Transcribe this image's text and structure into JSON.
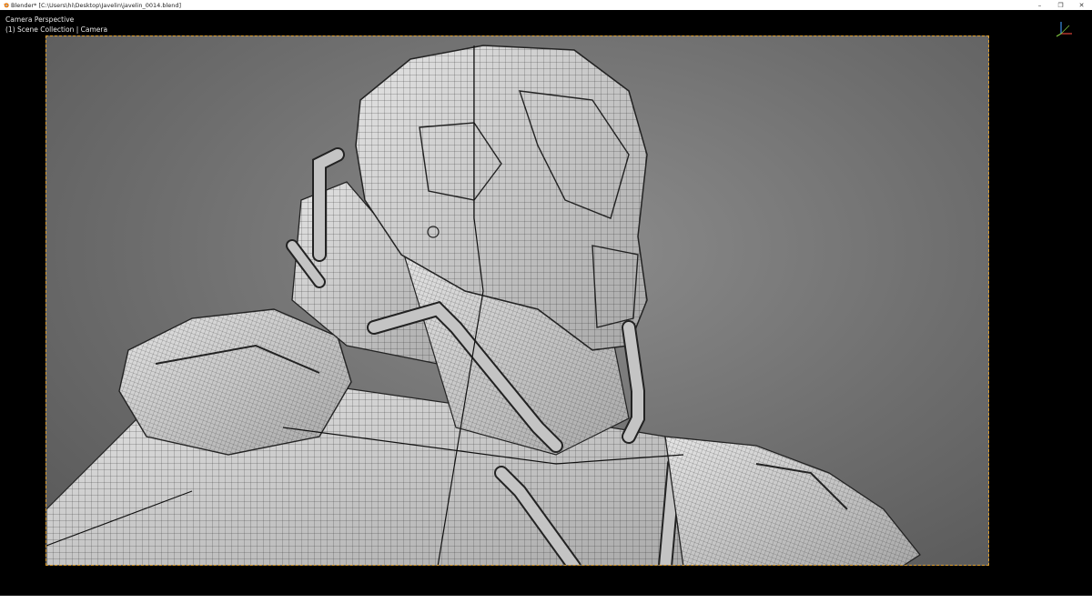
{
  "window": {
    "title": "Blender* [C:\\Users\\hi\\Desktop\\Javelin\\javelin_0014.blend]",
    "controls": {
      "minimize": "–",
      "restore": "❐",
      "close": "✕"
    }
  },
  "viewport": {
    "view_name": "Camera Perspective",
    "collection_info": "(1) Scene Collection | Camera"
  },
  "colors": {
    "frame_border": "#e0a030",
    "axis_x": "#e0443a",
    "axis_y": "#7ec640",
    "axis_z": "#3b8ee6"
  }
}
